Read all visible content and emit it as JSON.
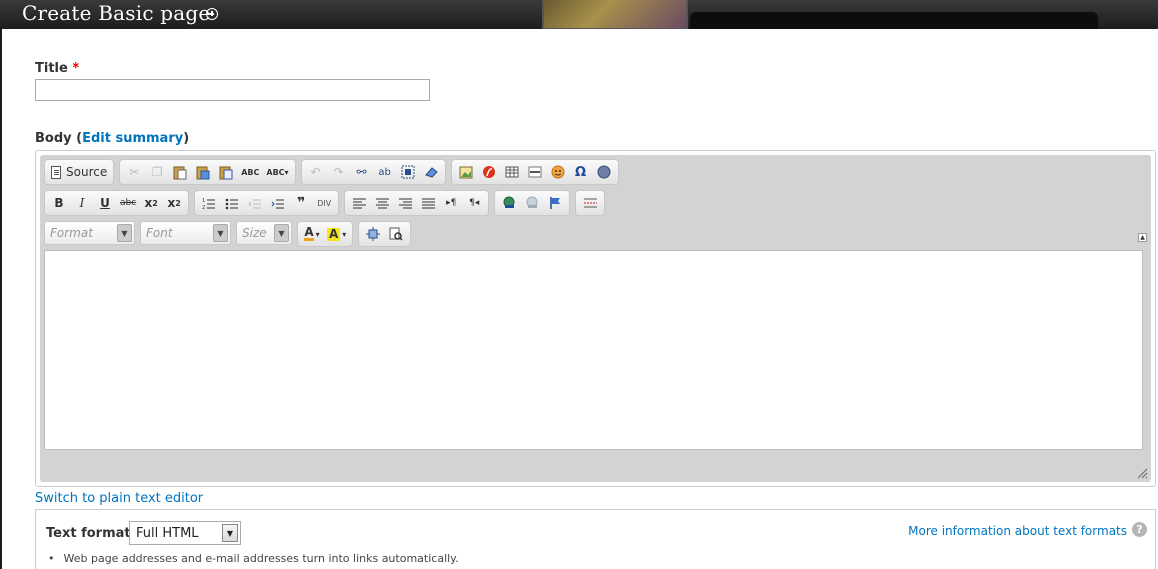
{
  "header": {
    "title": "Create Basic page",
    "shortcut_icon": "add-shortcut-icon"
  },
  "form": {
    "title_label": "Title",
    "required_marker": "*",
    "title_value": "",
    "body_label_prefix": "Body (",
    "edit_summary": "Edit summary",
    "body_label_suffix": ")"
  },
  "editor": {
    "source_label": "Source",
    "toolbar": {
      "row1": [
        [
          "source"
        ],
        [
          "cut-icon",
          "copy-icon",
          "paste-icon",
          "paste-text-icon",
          "paste-word-icon",
          "spellcheck-icon",
          "spellcheck-dropdown-icon"
        ],
        [
          "undo-icon",
          "redo-icon",
          "find-icon",
          "replace-icon",
          "select-all-icon",
          "remove-format-icon"
        ],
        [
          "image-icon",
          "flash-icon",
          "table-icon",
          "horizontal-rule-icon",
          "smiley-icon",
          "special-char-icon",
          "iframe-icon"
        ]
      ],
      "row2": [
        [
          "bold-icon",
          "italic-icon",
          "underline-icon",
          "strike-icon",
          "subscript-icon",
          "superscript-icon"
        ],
        [
          "numbered-list-icon",
          "bulleted-list-icon",
          "outdent-icon",
          "indent-icon",
          "blockquote-icon",
          "create-div-icon"
        ],
        [
          "align-left-icon",
          "align-center-icon",
          "align-right-icon",
          "justify-icon",
          "ltr-icon",
          "rtl-icon"
        ],
        [
          "link-icon",
          "unlink-icon",
          "anchor-icon"
        ],
        [
          "page-break-icon"
        ]
      ],
      "row3_combos": {
        "format": "Format",
        "font": "Font",
        "size": "Size"
      },
      "row3_icons": [
        "text-color-icon",
        "background-color-icon",
        "maximize-icon",
        "show-blocks-icon"
      ]
    }
  },
  "switch_link": "Switch to plain text editor",
  "text_format": {
    "label": "Text format",
    "selected": "Full HTML",
    "more_info": "More information about text formats",
    "help_icon": "?",
    "tip": "Web page addresses and e-mail addresses turn into links automatically."
  }
}
